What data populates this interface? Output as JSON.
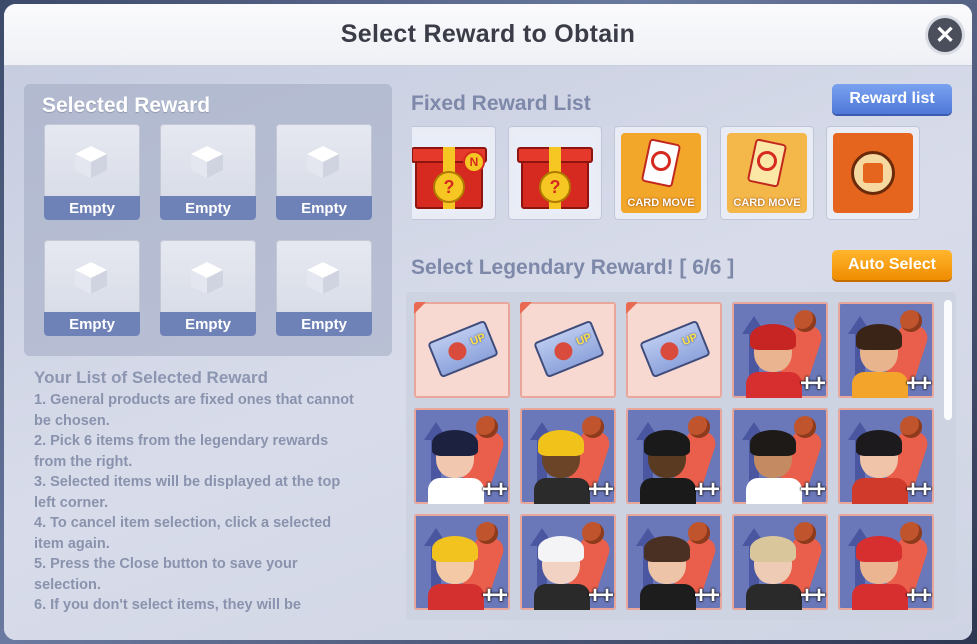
{
  "dialog": {
    "title": "Select Reward to Obtain",
    "close_label": "✕"
  },
  "selected_reward": {
    "title": "Selected Reward",
    "slots": [
      "Empty",
      "Empty",
      "Empty",
      "Empty",
      "Empty",
      "Empty"
    ]
  },
  "instructions": {
    "title": "Your List of Selected Reward",
    "lines": [
      "1. General products are fixed ones that cannot",
      "be chosen.",
      "2. Pick 6 items from the legendary rewards",
      "from the right.",
      "3. Selected items will be displayed at the top",
      "left corner.",
      "4. To cancel item selection, click a selected",
      "item again.",
      "5. Press the Close button to save your",
      "selection.",
      "6. If you don't select items, they will be"
    ]
  },
  "fixed_rewards": {
    "title": "Fixed Reward List",
    "button_label": "Reward list",
    "items": [
      {
        "kind": "gift-box-new",
        "label": "",
        "badge": "N"
      },
      {
        "kind": "gift-box",
        "label": ""
      },
      {
        "kind": "card-move",
        "label": "CARD MOVE"
      },
      {
        "kind": "card-move-gold",
        "label": "CARD MOVE"
      },
      {
        "kind": "swap-jersey",
        "label": ""
      }
    ]
  },
  "legendary": {
    "title": "Select Legendary Reward! [ 6/6 ]",
    "button_label": "Auto Select",
    "plus_label": "++",
    "up_label": "UP",
    "items": [
      {
        "kind": "ticket"
      },
      {
        "kind": "ticket"
      },
      {
        "kind": "ticket"
      },
      {
        "kind": "player",
        "skin": "#e9b48f",
        "hair": "#c72424",
        "shirt": "#d72f2f"
      },
      {
        "kind": "player",
        "skin": "#e8b48e",
        "hair": "#3a2418",
        "shirt": "#f2a52a"
      },
      {
        "kind": "player",
        "skin": "#f1c7b0",
        "hair": "#1d2140",
        "shirt": "#ffffff"
      },
      {
        "kind": "player",
        "skin": "#6b4326",
        "hair": "#f0c21a",
        "shirt": "#2b2b2b"
      },
      {
        "kind": "player",
        "skin": "#5a3b22",
        "hair": "#1a1a1a",
        "shirt": "#1a1a1a"
      },
      {
        "kind": "player",
        "skin": "#c48b62",
        "hair": "#1e1a18",
        "shirt": "#ffffff"
      },
      {
        "kind": "player",
        "skin": "#f0c4a8",
        "hair": "#1c1a1c",
        "shirt": "#cf3a2a"
      },
      {
        "kind": "player",
        "skin": "#f3c9a6",
        "hair": "#f2c21e",
        "shirt": "#d43030"
      },
      {
        "kind": "player",
        "skin": "#f2d2c2",
        "hair": "#f4f4f6",
        "shirt": "#2a2a2a"
      },
      {
        "kind": "player",
        "skin": "#eec4a8",
        "hair": "#4a3022",
        "shirt": "#1d1d1d"
      },
      {
        "kind": "player",
        "skin": "#eecbb4",
        "hair": "#d9c69a",
        "shirt": "#2a2a2a"
      },
      {
        "kind": "player",
        "skin": "#ecb592",
        "hair": "#d72f2f",
        "shirt": "#d72f2f"
      }
    ]
  }
}
